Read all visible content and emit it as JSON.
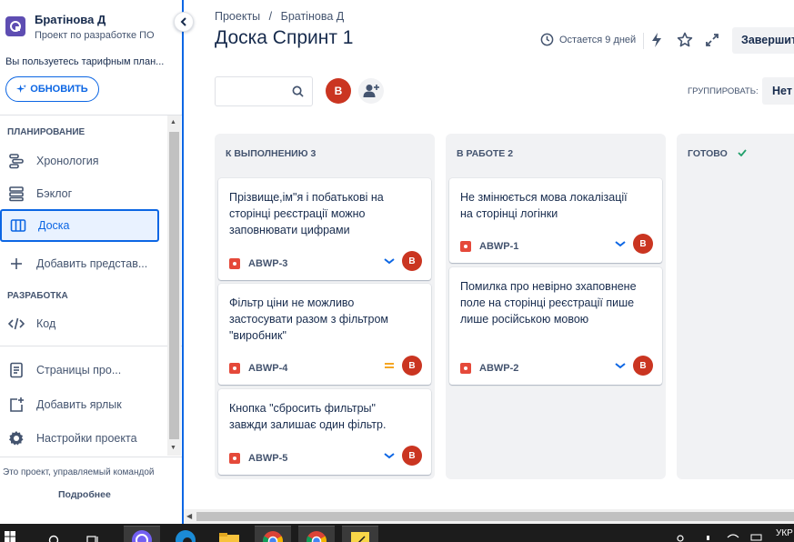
{
  "sidebar": {
    "project_name": "Братінова Д",
    "project_subtitle": "Проект по разработке ПО",
    "plan_notice": "Вы пользуетесь тарифным план...",
    "upgrade_label": "ОБНОВИТЬ",
    "planning_title": "ПЛАНИРОВАНИЕ",
    "planning_items": [
      {
        "label": "Хронология",
        "icon": "timeline-icon"
      },
      {
        "label": "Бэклог",
        "icon": "backlog-icon"
      },
      {
        "label": "Доска",
        "icon": "board-icon",
        "active": true
      }
    ],
    "add_view_label": "Добавить представ...",
    "development_title": "РАЗРАБОТКА",
    "code_label": "Код",
    "pages_label": "Страницы про...",
    "add_shortcut_label": "Добавить ярлык",
    "settings_label": "Настройки проекта",
    "footer_text": "Это проект, управляемый командой",
    "footer_link": "Подробнее"
  },
  "header": {
    "breadcrumb": [
      "Проекты",
      "/",
      "Братінова Д"
    ],
    "title": "Доска Спринт 1",
    "time_left": "Остается 9 дней",
    "complete_label": "Завершит",
    "group_label": "ГРУППИРОВАТЬ:",
    "group_value": "Нет"
  },
  "toolbar": {
    "search_placeholder": "",
    "avatar_letter": "В"
  },
  "board": {
    "columns": [
      {
        "title": "К ВЫПОЛНЕНИЮ 3",
        "cards": [
          {
            "title": "Прізвище,ім\"я і побатькові на сторінці реєстрації можно заповнювати цифрами",
            "key": "ABWP-3",
            "priority": "low",
            "assignee": "В"
          },
          {
            "title": "Фільтр ціни не можливо застосувати разом з фільтром \"виробник\"",
            "key": "ABWP-4",
            "priority": "medium",
            "assignee": "В"
          },
          {
            "title": "Кнопка \"сбросить фильтры\" завжди залишає один фільтр.",
            "key": "ABWP-5",
            "priority": "low",
            "assignee": "В"
          }
        ]
      },
      {
        "title": "В РАБОТЕ 2",
        "cards": [
          {
            "title": "Не змінюється мова локалізації на сторінці логінки",
            "key": "ABWP-1",
            "priority": "low",
            "assignee": "В"
          },
          {
            "title": "Помилка про невірно зхаповнене поле на сторінці реєстрації пише лише російською мовою",
            "key": "ABWP-2",
            "priority": "low",
            "assignee": "В"
          }
        ]
      },
      {
        "title": "ГОТОВО",
        "cards": []
      }
    ]
  },
  "taskbar": {
    "lang": "УКР"
  },
  "colors": {
    "accent": "#0c66e4",
    "avatar": "#ca3521",
    "bug": "#e5493a",
    "priority_low": "#0c66e4",
    "priority_medium": "#f5a623",
    "done_check": "#22a06b"
  }
}
